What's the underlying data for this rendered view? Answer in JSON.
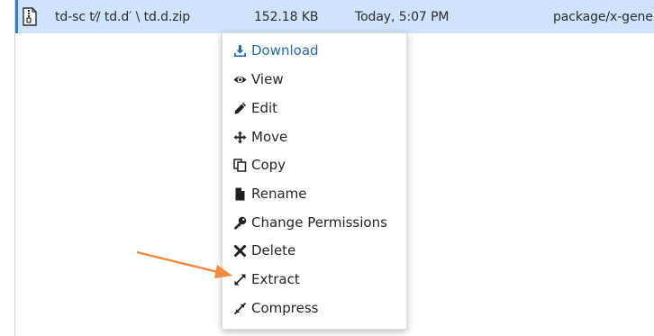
{
  "file_row": {
    "icon": "zip-file-icon",
    "name": "td-sc t⁄∕ td.d′ \\ td.d.zip",
    "size": "152.18 KB",
    "modified": "Today, 5:07 PM",
    "type": "package/x-gene"
  },
  "context_menu": {
    "items": [
      {
        "label": "Download",
        "icon": "download-icon"
      },
      {
        "label": "View",
        "icon": "eye-icon"
      },
      {
        "label": "Edit",
        "icon": "pencil-icon"
      },
      {
        "label": "Move",
        "icon": "move-arrows-icon"
      },
      {
        "label": "Copy",
        "icon": "copy-icon"
      },
      {
        "label": "Rename",
        "icon": "file-icon"
      },
      {
        "label": "Change Permissions",
        "icon": "key-icon"
      },
      {
        "label": "Delete",
        "icon": "x-icon"
      },
      {
        "label": "Extract",
        "icon": "expand-icon"
      },
      {
        "label": "Compress",
        "icon": "compress-icon"
      }
    ]
  },
  "colors": {
    "selected_row_bg": "#cfe4fb",
    "selected_row_border": "#2f81c7",
    "menu_active_text": "#2b6aa8",
    "annotation_arrow": "#f0883e"
  }
}
